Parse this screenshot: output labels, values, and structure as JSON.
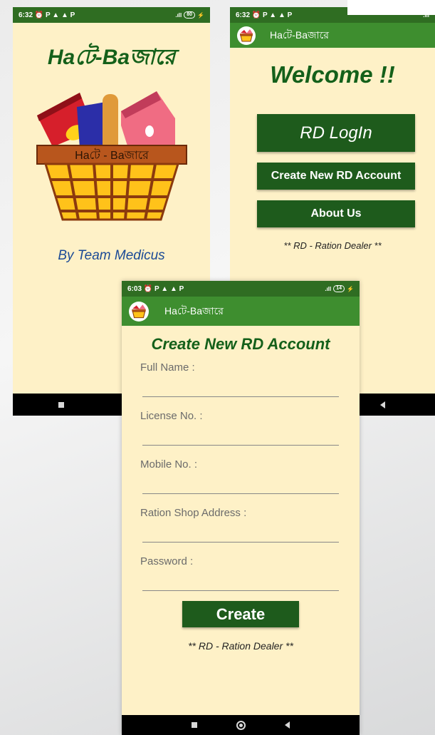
{
  "colors": {
    "accent_green": "#3e8e2f",
    "dark_green": "#1e5b1c",
    "title_green": "#14601a",
    "background": "#fef1c7",
    "byline_blue": "#1a4a96"
  },
  "splash": {
    "status_time": "6:32",
    "status_icons": "⏰ P ▲ ▲ P",
    "battery": "80",
    "title": "Haটে-Baজারে",
    "logo_label": "Haটে - Baজারে",
    "byline": "By Team Medicus"
  },
  "home": {
    "status_time": "6:32",
    "status_icons": "⏰ P ▲ ▲ P",
    "app_title": "Haটে-Baজারে",
    "welcome": "Welcome !!",
    "login_button": "RD LogIn",
    "create_button": "Create New RD Account",
    "about_button": "About Us",
    "note": "** RD - Ration Dealer **"
  },
  "create": {
    "status_time": "6:03",
    "status_icons": "⏰ P ▲ ▲ P",
    "battery": "14",
    "app_title": "Haটে-Baজারে",
    "title": "Create New RD Account",
    "fields": [
      {
        "label": "Full Name :"
      },
      {
        "label": "License No. :"
      },
      {
        "label": "Mobile No. :"
      },
      {
        "label": "Ration Shop Address :"
      },
      {
        "label": "Password :"
      }
    ],
    "submit_button": "Create",
    "note": "** RD - Ration Dealer **"
  }
}
